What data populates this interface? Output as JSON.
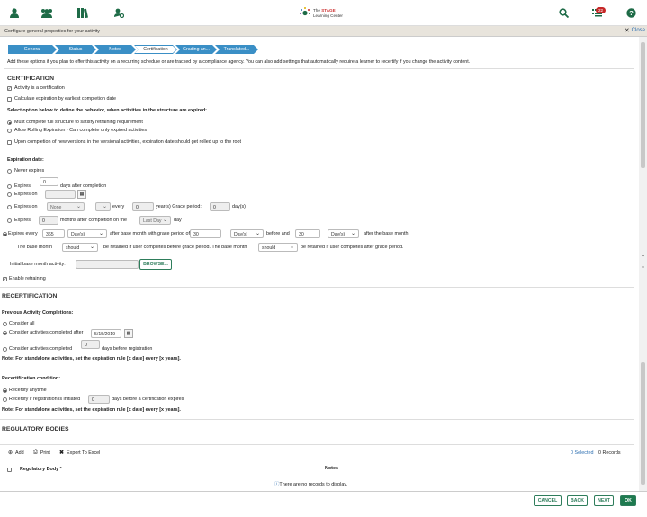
{
  "header": {
    "logo_line1_pre": "The",
    "logo_line1_brand": "STAGE",
    "logo_line2": "Learning Center",
    "notification_count": "22",
    "icons": [
      "user-icon",
      "group-icon",
      "library-icon",
      "user-settings-icon",
      "search-icon",
      "notifications-icon",
      "help-icon"
    ]
  },
  "subheader": {
    "title": "Configure general properties for your activity",
    "close_label": "Close"
  },
  "tabs": [
    "General",
    "Status",
    "Notes",
    "Certification",
    "Grading an...",
    "Translated..."
  ],
  "intro": "Add these options if you plan to offer this activity on a recurring schedule or are tracked by a compliance agency. You can also add settings that automatically require a learner to recertify if you change the activity content.",
  "certification": {
    "heading": "CERTIFICATION",
    "activity_is_cert": "Activity is a certification",
    "calc_expiration": "Calculate expiration by earliest completion date",
    "structure_prompt": "Select option below to define the behavior, when activities in the structure are expired:",
    "opt_full": "Must complete full structure to satisfy retraining requirement",
    "opt_rolling": "Allow Rolling Expiration - Can complete only expired activities",
    "rollup": "Upon completion of new versions in the versional activities, expiration date should get rolled up to the root",
    "expiration_label": "Expiration date:",
    "never": "Never expires",
    "expires": "Expires",
    "days_value": "0",
    "days_after": "days after completion",
    "expires_on": "Expires on",
    "expires_on2": "Expires on",
    "none_option": "None",
    "every": "every",
    "years_value": "0",
    "years_grace": "year(s) Grace period:",
    "grace_value": "0",
    "days_unit": "day(s)",
    "expires_months": "Expires",
    "months_value": "0",
    "months_after": "months after completion on the",
    "last_day": "Last Day",
    "day_word": "day",
    "expires_every": "Expires every",
    "every_value": "365",
    "days_select": "Day(s)",
    "after_base_grace": "after base month with grace period of",
    "grace_value2": "30",
    "days_select2": "Day(s)",
    "before_and": "before and",
    "after_value": "30",
    "days_select3": "Day(s)",
    "after_base": "after the base month.",
    "base_month": "The base month",
    "should1": "should",
    "retained_before": "be retained if user completes before grace period. The base month",
    "should2": "should",
    "retained_after": "be retained if user completes after grace period.",
    "initial_base": "Initial base month activity:",
    "browse": "BROWSE...",
    "enable_retraining": "Enable retraining"
  },
  "recertification": {
    "heading": "RECERTIFICATION",
    "prev_label": "Previous Activity Completions:",
    "consider_all": "Consider all",
    "consider_after": "Consider activities completed after",
    "date_value": "5/15/2019",
    "consider_completed": "Consider activities completed",
    "days_value": "0",
    "days_before": "days before registration",
    "note1": "Note: For standalone activities, set the expiration rule [x date] every [x years].",
    "condition_label": "Recertification condition:",
    "anytime": "Recertify anytime",
    "if_initiated": "Recertify if registration is initiated",
    "init_value": "0",
    "days_before_cert": "days before a certification expires",
    "note2": "Note: For standalone activities, set the expiration rule [x date] every [x years]."
  },
  "regulatory": {
    "heading": "REGULATORY BODIES",
    "add": "Add",
    "print": "Print",
    "export": "Export To Excel",
    "selected": "0 Selected",
    "records": "0 Records",
    "col_body": "Regulatory Body *",
    "col_notes": "Notes",
    "empty": "There are no records to display."
  },
  "footer": {
    "cancel": "CANCEL",
    "back": "BACK",
    "next": "NEXT",
    "ok": "OK"
  },
  "colors": {
    "tab": "#3a8fc6",
    "primary": "#1e7a4f",
    "badge": "#c62828",
    "header_icons": "#1e6b47"
  }
}
